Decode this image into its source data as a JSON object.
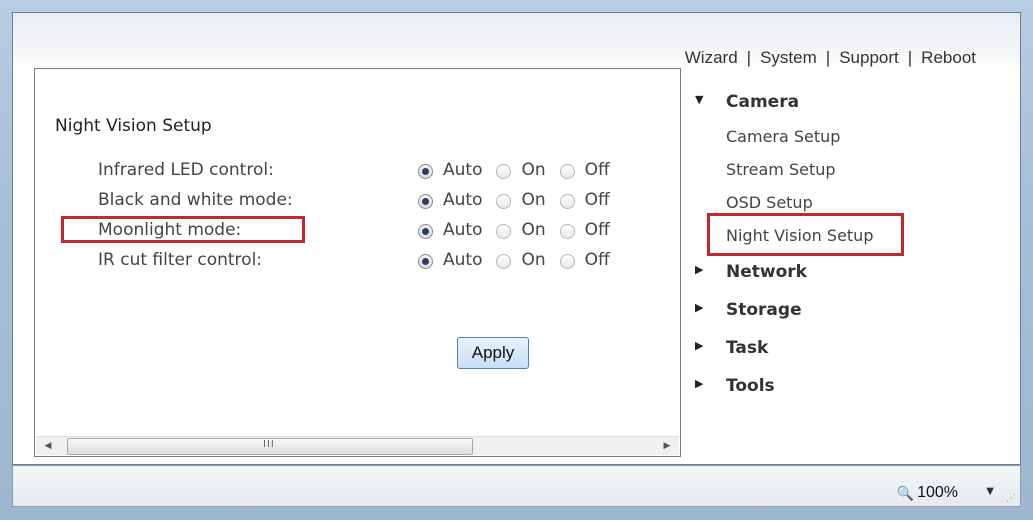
{
  "topnav": {
    "wizard": "Wizard",
    "system": "System",
    "support": "Support",
    "reboot": "Reboot",
    "separator": "|"
  },
  "panel": {
    "title": "Night Vision Setup",
    "rows": [
      {
        "label": "Infrared LED control:",
        "selected": "Auto"
      },
      {
        "label": "Black and white mode:",
        "selected": "Auto"
      },
      {
        "label": "Moonlight mode:",
        "selected": "Auto"
      },
      {
        "label": "IR cut filter control:",
        "selected": "Auto"
      }
    ],
    "options": [
      "Auto",
      "On",
      "Off"
    ],
    "apply_label": "Apply",
    "scroll_grip": "III"
  },
  "menu": {
    "camera": "Camera",
    "camera_items": [
      "Camera Setup",
      "Stream Setup",
      "OSD Setup",
      "Night Vision Setup"
    ],
    "network": "Network",
    "storage": "Storage",
    "task": "Task",
    "tools": "Tools"
  },
  "status": {
    "zoom": "100%"
  },
  "colors": {
    "highlight": "#c0282e",
    "radio_selected": "#2a3d66"
  }
}
